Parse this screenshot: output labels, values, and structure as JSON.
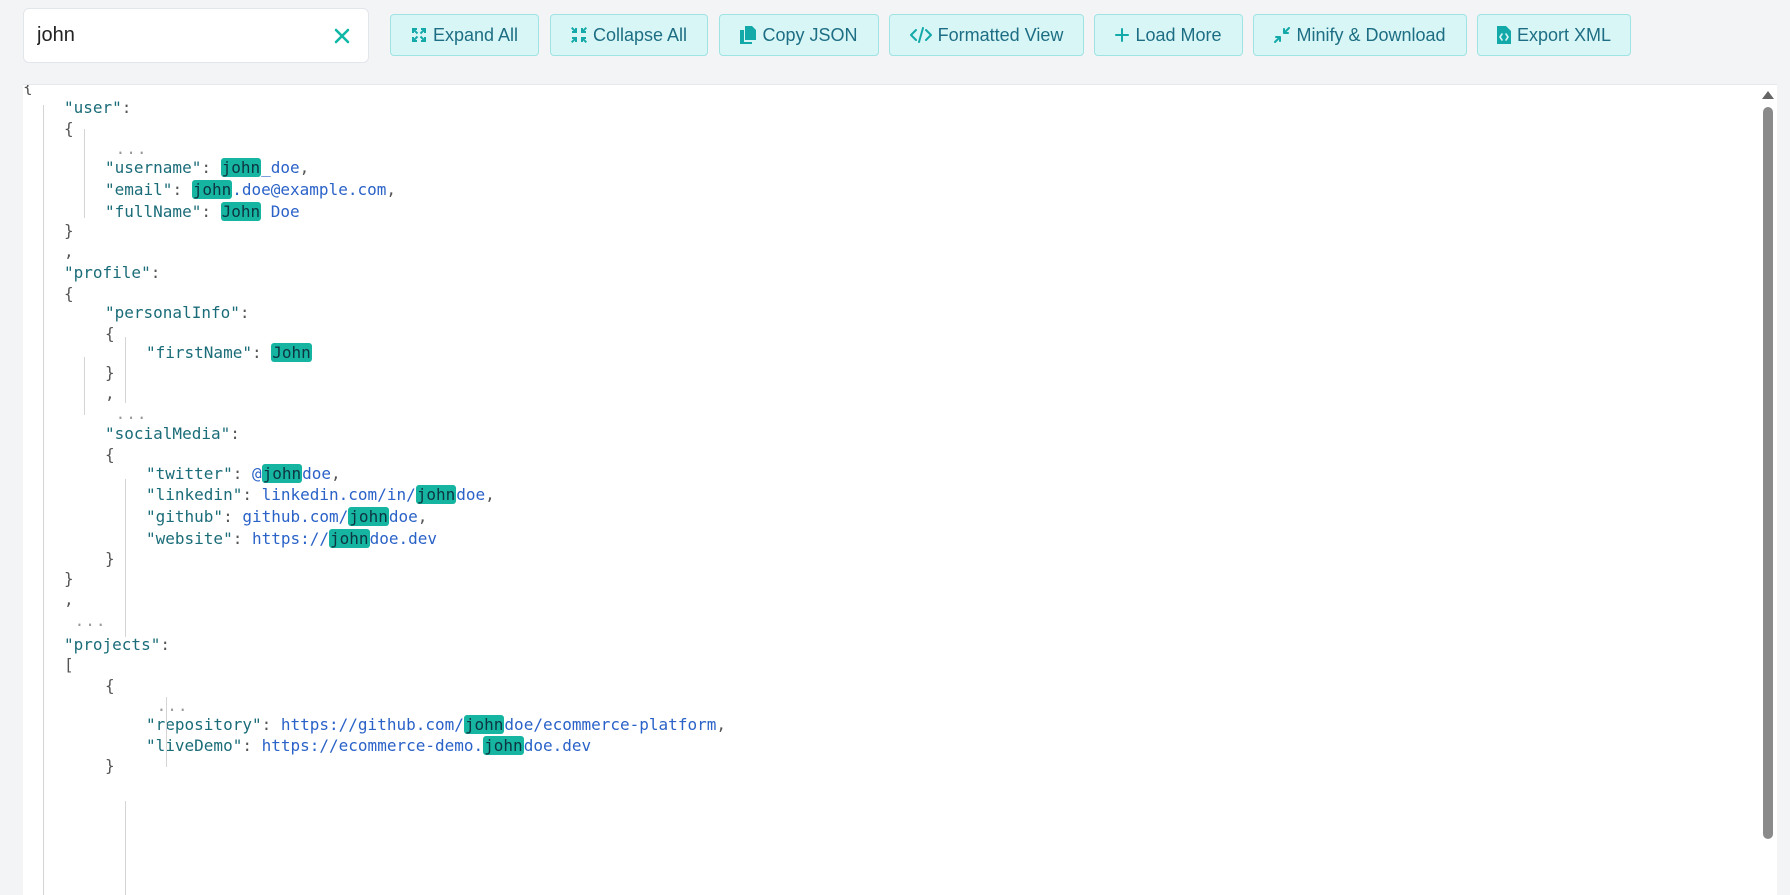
{
  "search": {
    "value": "john"
  },
  "toolbar": {
    "buttons": [
      {
        "label": "Expand All",
        "icon": "expand-icon"
      },
      {
        "label": "Collapse All",
        "icon": "collapse-icon"
      },
      {
        "label": "Copy JSON",
        "icon": "copy-icon"
      },
      {
        "label": "Formatted View",
        "icon": "code-icon"
      },
      {
        "label": "Load More",
        "icon": "plus-icon"
      },
      {
        "label": "Minify & Download",
        "icon": "minify-icon"
      },
      {
        "label": "Export XML",
        "icon": "file-code-icon"
      }
    ]
  },
  "colors": {
    "accent": "#16b5a1",
    "key": "#1a6c78",
    "value": "#2a62c8",
    "button_bg": "#d8f6f6"
  },
  "tree": [
    {
      "indent": 0,
      "parts": [
        {
          "t": "p",
          "s": "{"
        }
      ]
    },
    {
      "indent": 1,
      "parts": [
        {
          "t": "k",
          "s": "\"user\""
        },
        {
          "t": "p",
          "s": ":"
        }
      ]
    },
    {
      "indent": 1,
      "parts": [
        {
          "t": "p",
          "s": "{"
        }
      ]
    },
    {
      "indent": 2,
      "parts": [
        {
          "t": "d",
          "s": " ..."
        }
      ]
    },
    {
      "indent": 2,
      "parts": [
        {
          "t": "k",
          "s": "\"username\""
        },
        {
          "t": "p",
          "s": ": "
        },
        {
          "t": "h",
          "s": "john"
        },
        {
          "t": "v",
          "s": "_doe"
        },
        {
          "t": "p",
          "s": ","
        }
      ]
    },
    {
      "indent": 2,
      "parts": [
        {
          "t": "k",
          "s": "\"email\""
        },
        {
          "t": "p",
          "s": ": "
        },
        {
          "t": "h",
          "s": "john"
        },
        {
          "t": "v",
          "s": ".doe@example.com"
        },
        {
          "t": "p",
          "s": ","
        }
      ]
    },
    {
      "indent": 2,
      "parts": [
        {
          "t": "k",
          "s": "\"fullName\""
        },
        {
          "t": "p",
          "s": ": "
        },
        {
          "t": "h",
          "s": "John"
        },
        {
          "t": "v",
          "s": " Doe"
        }
      ]
    },
    {
      "indent": 1,
      "parts": [
        {
          "t": "p",
          "s": "}"
        }
      ]
    },
    {
      "indent": 1,
      "parts": [
        {
          "t": "p",
          "s": ","
        }
      ]
    },
    {
      "indent": 1,
      "parts": [
        {
          "t": "k",
          "s": "\"profile\""
        },
        {
          "t": "p",
          "s": ":"
        }
      ]
    },
    {
      "indent": 1,
      "parts": [
        {
          "t": "p",
          "s": "{"
        }
      ]
    },
    {
      "indent": 2,
      "parts": [
        {
          "t": "k",
          "s": "\"personalInfo\""
        },
        {
          "t": "p",
          "s": ":"
        }
      ]
    },
    {
      "indent": 2,
      "parts": [
        {
          "t": "p",
          "s": "{"
        }
      ]
    },
    {
      "indent": 3,
      "parts": [
        {
          "t": "k",
          "s": "\"firstName\""
        },
        {
          "t": "p",
          "s": ": "
        },
        {
          "t": "h",
          "s": "John"
        }
      ]
    },
    {
      "indent": 2,
      "parts": [
        {
          "t": "p",
          "s": "}"
        }
      ]
    },
    {
      "indent": 2,
      "parts": [
        {
          "t": "p",
          "s": ","
        }
      ]
    },
    {
      "indent": 2,
      "parts": [
        {
          "t": "d",
          "s": " ..."
        }
      ]
    },
    {
      "indent": 2,
      "parts": [
        {
          "t": "k",
          "s": "\"socialMedia\""
        },
        {
          "t": "p",
          "s": ":"
        }
      ]
    },
    {
      "indent": 2,
      "parts": [
        {
          "t": "p",
          "s": "{"
        }
      ]
    },
    {
      "indent": 3,
      "parts": [
        {
          "t": "k",
          "s": "\"twitter\""
        },
        {
          "t": "p",
          "s": ": "
        },
        {
          "t": "v",
          "s": "@"
        },
        {
          "t": "h",
          "s": "john"
        },
        {
          "t": "v",
          "s": "doe"
        },
        {
          "t": "p",
          "s": ","
        }
      ]
    },
    {
      "indent": 3,
      "parts": [
        {
          "t": "k",
          "s": "\"linkedin\""
        },
        {
          "t": "p",
          "s": ": "
        },
        {
          "t": "v",
          "s": "linkedin.com/in/"
        },
        {
          "t": "h",
          "s": "john"
        },
        {
          "t": "v",
          "s": "doe"
        },
        {
          "t": "p",
          "s": ","
        }
      ]
    },
    {
      "indent": 3,
      "parts": [
        {
          "t": "k",
          "s": "\"github\""
        },
        {
          "t": "p",
          "s": ": "
        },
        {
          "t": "v",
          "s": "github.com/"
        },
        {
          "t": "h",
          "s": "john"
        },
        {
          "t": "v",
          "s": "doe"
        },
        {
          "t": "p",
          "s": ","
        }
      ]
    },
    {
      "indent": 3,
      "parts": [
        {
          "t": "k",
          "s": "\"website\""
        },
        {
          "t": "p",
          "s": ": "
        },
        {
          "t": "v",
          "s": "https://"
        },
        {
          "t": "h",
          "s": "john"
        },
        {
          "t": "v",
          "s": "doe.dev"
        }
      ]
    },
    {
      "indent": 2,
      "parts": [
        {
          "t": "p",
          "s": "}"
        }
      ]
    },
    {
      "indent": 1,
      "parts": [
        {
          "t": "p",
          "s": "}"
        }
      ]
    },
    {
      "indent": 1,
      "parts": [
        {
          "t": "p",
          "s": ","
        }
      ]
    },
    {
      "indent": 1,
      "parts": [
        {
          "t": "d",
          "s": " ..."
        }
      ]
    },
    {
      "indent": 1,
      "parts": [
        {
          "t": "k",
          "s": "\"projects\""
        },
        {
          "t": "p",
          "s": ":"
        }
      ]
    },
    {
      "indent": 1,
      "parts": [
        {
          "t": "p",
          "s": "["
        }
      ]
    },
    {
      "indent": 2,
      "parts": [
        {
          "t": "p",
          "s": "{"
        }
      ]
    },
    {
      "indent": 3,
      "parts": [
        {
          "t": "d",
          "s": " ..."
        }
      ]
    },
    {
      "indent": 3,
      "parts": [
        {
          "t": "k",
          "s": "\"repository\""
        },
        {
          "t": "p",
          "s": ": "
        },
        {
          "t": "v",
          "s": "https://github.com/"
        },
        {
          "t": "h",
          "s": "john"
        },
        {
          "t": "v",
          "s": "doe/ecommerce-platform"
        },
        {
          "t": "p",
          "s": ","
        }
      ]
    },
    {
      "indent": 3,
      "parts": [
        {
          "t": "k",
          "s": "\"liveDemo\""
        },
        {
          "t": "p",
          "s": ": "
        },
        {
          "t": "v",
          "s": "https://ecommerce-demo."
        },
        {
          "t": "h",
          "s": "john"
        },
        {
          "t": "v",
          "s": "doe.dev"
        }
      ]
    },
    {
      "indent": 2,
      "parts": [
        {
          "t": "p",
          "s": "}"
        }
      ]
    }
  ]
}
